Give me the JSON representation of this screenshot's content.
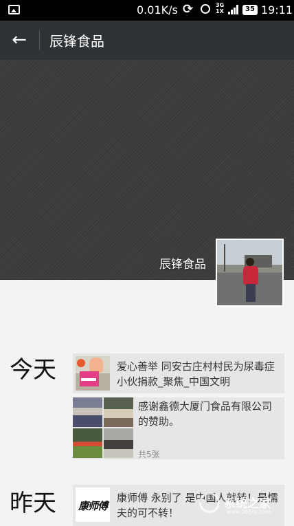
{
  "status_bar": {
    "speed": "0.01K/s",
    "network": [
      "3G",
      "1X"
    ],
    "battery": "35",
    "time": "19:11",
    "icons": [
      "gallery-icon",
      "sync-icon",
      "alarm-icon",
      "signal-icon",
      "battery-icon"
    ]
  },
  "app_bar": {
    "title": "辰锋食品",
    "back_icon": "arrow-left-icon"
  },
  "cover": {
    "name": "辰锋食品",
    "avatar_icon": "avatar-photo"
  },
  "feed": [
    {
      "day": "今天",
      "posts": [
        {
          "text": "爱心善举 同安古庄村村民为尿毒症小伙捐款_聚焦_中国文明",
          "thumb": "charity-photo"
        },
        {
          "text": "感谢鑫德大厦门食品有限公司的赞助。",
          "count": "共5张",
          "thumbs": [
            "photo-1",
            "photo-2",
            "photo-3",
            "photo-4"
          ]
        }
      ]
    },
    {
      "day": "昨天",
      "posts": [
        {
          "text": "康师傅  永别了  是中国人就转！是懦夫的可不转！",
          "thumb": "康师傅"
        }
      ]
    }
  ],
  "watermark": {
    "name": "系统之家",
    "url": "www.365ta.com"
  },
  "colors": {
    "app_bar": "#303335",
    "status_bar": "#000000",
    "cover": "#3c3c3c",
    "post_bg": "#e6e6e6",
    "page_bg": "#f3f3f3"
  }
}
